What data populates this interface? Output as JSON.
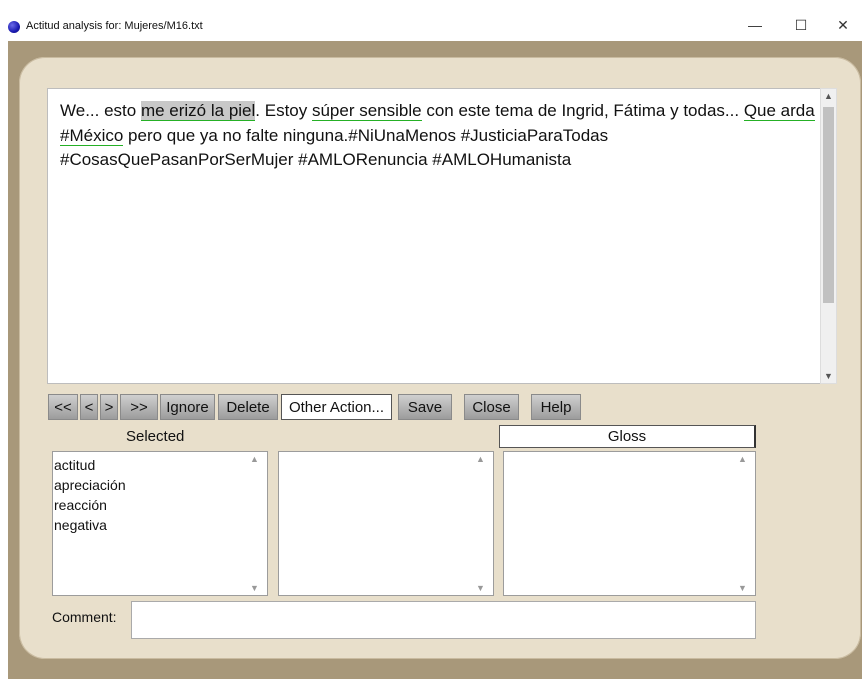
{
  "window": {
    "title": "Actitud analysis for: Mujeres/M16.txt",
    "minimize": "—",
    "maximize": "☐",
    "close": "✕"
  },
  "text": {
    "s1": "We... esto ",
    "s2": "me erizó la piel",
    "s3": ".  Estoy ",
    "s4": "súper sensible",
    "s5": " con este tema de Ingrid, Fátima y todas... ",
    "s6": "Que arda #México",
    "s7": " pero que ya no falte ninguna.#NiUnaMenos #JusticiaParaTodas #CosasQuePasanPorSerMujer #AMLORenuncia #AMLOHumanista"
  },
  "toolbar": {
    "first": "<<",
    "prev": "<",
    "next": ">",
    "last": ">>",
    "ignore": "Ignore",
    "delete": "Delete",
    "other": "Other Action...",
    "save": "Save",
    "close": "Close",
    "help": "Help"
  },
  "panels": {
    "selected_label": "Selected",
    "gloss_label": "Gloss",
    "selected_items": [
      "actitud",
      "apreciación",
      "reacción",
      "negativa"
    ]
  },
  "comment": {
    "label": "Comment:",
    "value": ""
  },
  "icons": {
    "app": "app-globe-icon",
    "scroll_up": "▲",
    "scroll_down": "▼"
  }
}
